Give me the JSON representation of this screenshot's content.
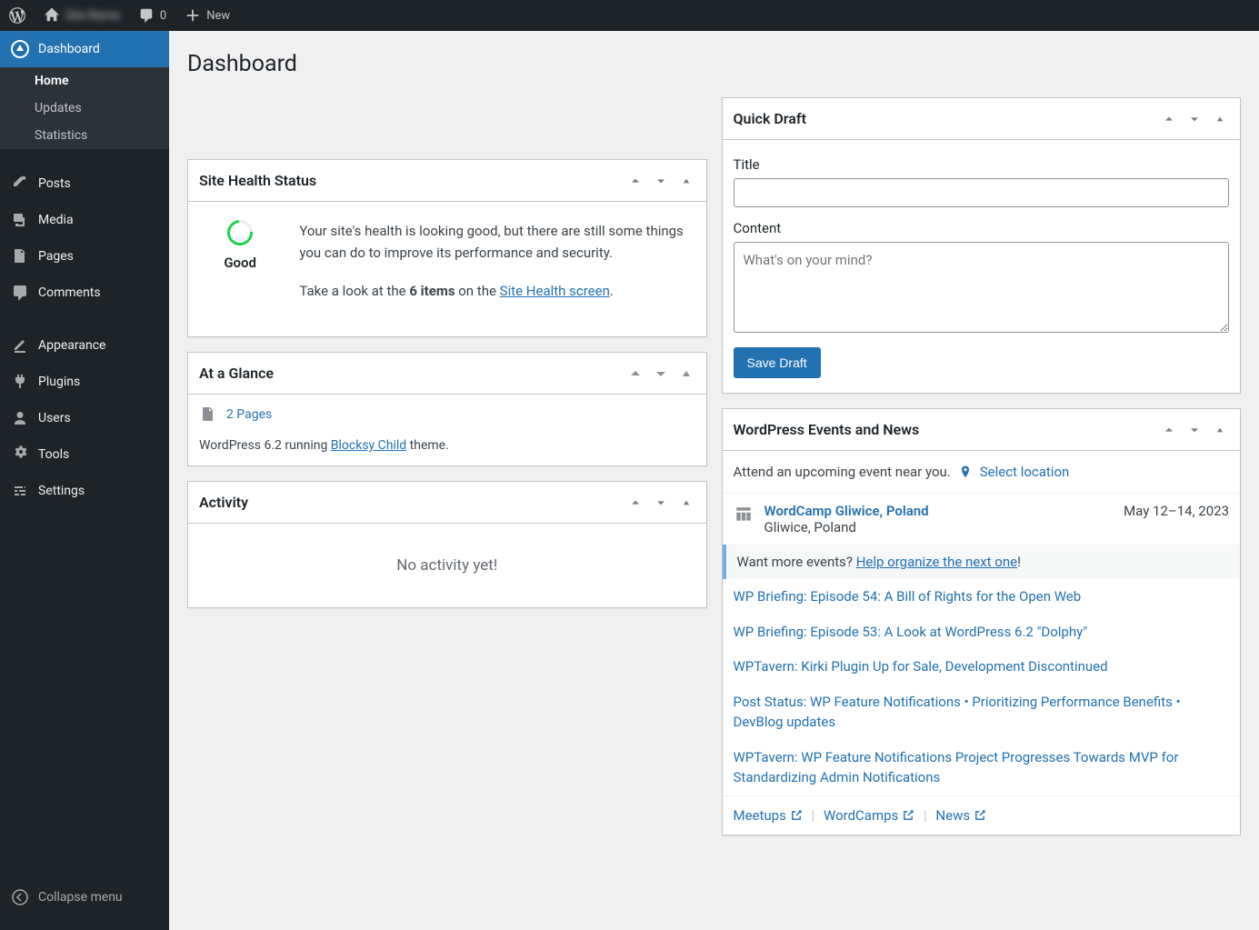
{
  "adminbar": {
    "site_name": "Site Name",
    "comments_count": "0",
    "new_label": "New"
  },
  "sidebar": {
    "dashboard": "Dashboard",
    "subitems": {
      "home": "Home",
      "updates": "Updates",
      "statistics": "Statistics"
    },
    "posts": "Posts",
    "media": "Media",
    "pages": "Pages",
    "comments": "Comments",
    "appearance": "Appearance",
    "plugins": "Plugins",
    "users": "Users",
    "tools": "Tools",
    "settings": "Settings",
    "collapse": "Collapse menu"
  },
  "page": {
    "title": "Dashboard"
  },
  "site_health": {
    "title": "Site Health Status",
    "status": "Good",
    "description": "Your site's health is looking good, but there are still some things you can do to improve its performance and security.",
    "line2_pre": "Take a look at the ",
    "items": "6 items",
    "line2_mid": " on the ",
    "link": "Site Health screen",
    "line2_post": "."
  },
  "glance": {
    "title": "At a Glance",
    "pages_count": "2 Pages",
    "version_pre": "WordPress 6.2 running ",
    "theme": "Blocksy Child",
    "version_post": " theme."
  },
  "activity": {
    "title": "Activity",
    "empty": "No activity yet!"
  },
  "quick_draft": {
    "title": "Quick Draft",
    "title_label": "Title",
    "content_label": "Content",
    "content_placeholder": "What's on your mind?",
    "save": "Save Draft"
  },
  "events": {
    "title": "WordPress Events and News",
    "attend": "Attend an upcoming event near you.",
    "select_location": "Select location",
    "event_title": "WordCamp Gliwice, Poland",
    "event_loc": "Gliwice, Poland",
    "event_date": "May 12–14, 2023",
    "want_more": "Want more events? ",
    "want_link": "Help organize the next one",
    "want_bang": "!",
    "news": [
      "WP Briefing: Episode 54: A Bill of Rights for the Open Web",
      "WP Briefing: Episode 53: A Look at WordPress 6.2 \"Dolphy\"",
      "WPTavern: Kirki Plugin Up for Sale, Development Discontinued",
      "Post Status: WP Feature Notifications • Prioritizing Performance Benefits • DevBlog updates",
      "WPTavern: WP Feature Notifications Project Progresses Towards MVP for Standardizing Admin Notifications"
    ],
    "meetups": "Meetups",
    "wordcamps": "WordCamps",
    "newslink": "News"
  }
}
